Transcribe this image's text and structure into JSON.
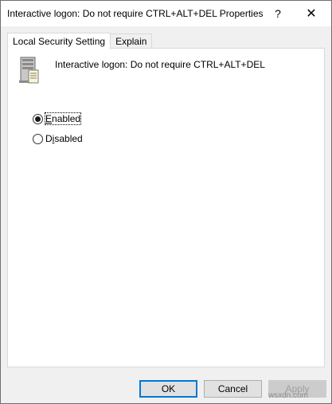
{
  "window": {
    "title": "Interactive logon: Do not require CTRL+ALT+DEL Properties",
    "help_glyph": "?",
    "close_glyph": "✕"
  },
  "tabs": [
    {
      "label": "Local Security Setting",
      "active": true
    },
    {
      "label": "Explain",
      "active": false
    }
  ],
  "policy": {
    "icon": "server-policy-icon",
    "name": "Interactive logon: Do not require CTRL+ALT+DEL"
  },
  "options": {
    "enabled": {
      "accel": "E",
      "rest": "nabled",
      "checked": true
    },
    "disabled": {
      "prefix": "D",
      "accel": "i",
      "rest": "sabled",
      "checked": false
    }
  },
  "buttons": {
    "ok": "OK",
    "cancel": "Cancel",
    "apply": "Apply"
  },
  "watermark": "wsxdn.com",
  "colors": {
    "focus_border": "#0078d7",
    "disabled_text": "#a0a0a0"
  }
}
